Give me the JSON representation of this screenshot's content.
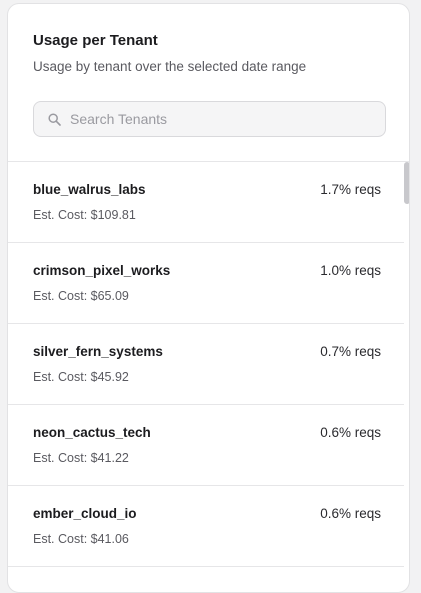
{
  "header": {
    "title": "Usage per Tenant",
    "subtitle": "Usage by tenant over the selected date range"
  },
  "search": {
    "placeholder": "Search Tenants",
    "value": "",
    "icon": "search-icon"
  },
  "tenants": [
    {
      "name": "blue_walrus_labs",
      "pct": "1.7% reqs",
      "cost": "Est. Cost: $109.81"
    },
    {
      "name": "crimson_pixel_works",
      "pct": "1.0% reqs",
      "cost": "Est. Cost: $65.09"
    },
    {
      "name": "silver_fern_systems",
      "pct": "0.7% reqs",
      "cost": "Est. Cost: $45.92"
    },
    {
      "name": "neon_cactus_tech",
      "pct": "0.6% reqs",
      "cost": "Est. Cost: $41.22"
    },
    {
      "name": "ember_cloud_io",
      "pct": "0.6% reqs",
      "cost": "Est. Cost: $41.06"
    }
  ]
}
